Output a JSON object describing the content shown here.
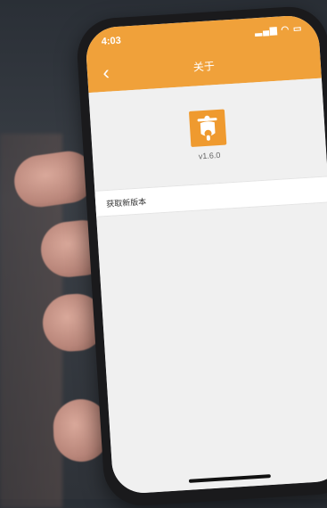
{
  "status_bar": {
    "time": "4:03",
    "icons": "signal wifi battery"
  },
  "nav": {
    "title": "关于",
    "back_icon": "chevron-left-icon"
  },
  "about": {
    "version": "v1.6.0",
    "app_icon": "scooter-app-icon"
  },
  "list": {
    "items": [
      {
        "label": "获取新版本"
      }
    ]
  },
  "colors": {
    "accent": "#f0a13a",
    "background": "#f0f0f0"
  }
}
